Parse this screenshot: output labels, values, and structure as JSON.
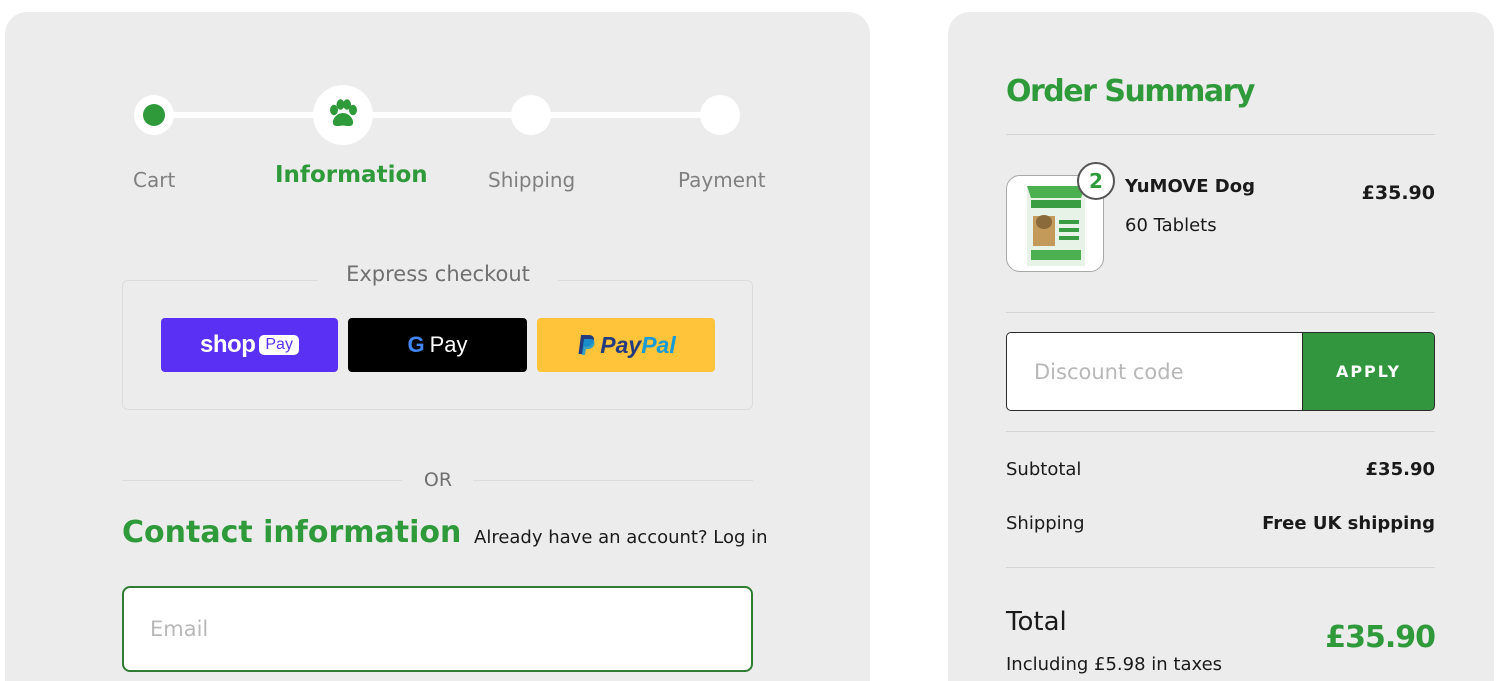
{
  "progress": {
    "steps": [
      {
        "label": "Cart",
        "state": "done"
      },
      {
        "label": "Information",
        "state": "current"
      },
      {
        "label": "Shipping",
        "state": "upcoming"
      },
      {
        "label": "Payment",
        "state": "upcoming"
      }
    ]
  },
  "express_checkout": {
    "title": "Express checkout",
    "shop_pay": {
      "word": "shop",
      "pill": "Pay"
    },
    "google_pay": {
      "g": "G",
      "word": "Pay"
    },
    "paypal": {
      "part1": "Pay",
      "part2": "Pal"
    },
    "or_text": "OR"
  },
  "contact": {
    "title": "Contact information",
    "account_prompt": "Already have an account?",
    "login_link": "Log in",
    "email_placeholder": "Email"
  },
  "order_summary": {
    "title": "Order Summary",
    "item": {
      "quantity": "2",
      "name": "YuMOVE Dog",
      "variant": "60 Tablets",
      "price": "£35.90"
    },
    "discount": {
      "placeholder": "Discount code",
      "apply_label": "APPLY"
    },
    "subtotal": {
      "label": "Subtotal",
      "value": "£35.90"
    },
    "shipping": {
      "label": "Shipping",
      "value": "Free UK shipping"
    },
    "total": {
      "label": "Total",
      "value": "£35.90",
      "tax_note": "Including £5.98 in taxes"
    }
  },
  "colors": {
    "brand_green": "#2e9a3a",
    "panel_bg": "#ececec",
    "shop_pay": "#5a31f4",
    "paypal_yellow": "#ffc439"
  },
  "icons": [
    "paw-icon",
    "google-g-icon",
    "paypal-p-icon"
  ]
}
